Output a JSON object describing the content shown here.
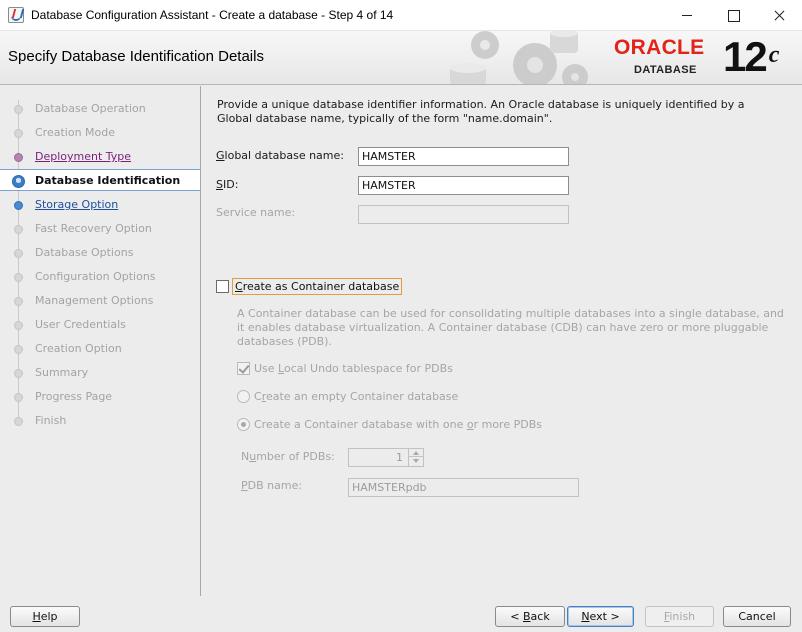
{
  "window": {
    "title": "Database Configuration Assistant - Create a database - Step 4 of 14"
  },
  "header": {
    "page_title": "Specify Database Identification Details",
    "brand_oracle": "ORACLE",
    "brand_database": "DATABASE",
    "brand_version": "12",
    "brand_version_sup": "c"
  },
  "nav": {
    "steps": [
      {
        "label": "Database Operation",
        "state": "inactive"
      },
      {
        "label": "Creation Mode",
        "state": "inactive"
      },
      {
        "label": "Deployment Type",
        "state": "done"
      },
      {
        "label": "Database Identification",
        "state": "current"
      },
      {
        "label": "Storage Option",
        "state": "next"
      },
      {
        "label": "Fast Recovery Option",
        "state": "inactive"
      },
      {
        "label": "Database Options",
        "state": "inactive"
      },
      {
        "label": "Configuration Options",
        "state": "inactive"
      },
      {
        "label": "Management Options",
        "state": "inactive"
      },
      {
        "label": "User Credentials",
        "state": "inactive"
      },
      {
        "label": "Creation Option",
        "state": "inactive"
      },
      {
        "label": "Summary",
        "state": "inactive"
      },
      {
        "label": "Progress Page",
        "state": "inactive"
      },
      {
        "label": "Finish",
        "state": "inactive"
      }
    ]
  },
  "main": {
    "intro": "Provide a unique database identifier information. An Oracle database is uniquely identified by a Global database name, typically of the form \"name.domain\".",
    "global_db_name": {
      "mnemonic": "G",
      "label_rest": "lobal database name:",
      "value": "HAMSTER"
    },
    "sid": {
      "mnemonic": "S",
      "label_rest": "ID:",
      "value": "HAMSTER"
    },
    "service_name": {
      "label": "Service name:",
      "value": ""
    },
    "container": {
      "checkbox_mnemonic": "C",
      "checkbox_label_rest": "reate as Container database",
      "checked": false,
      "description": "A Container database can be used for consolidating multiple databases into a single database, and it enables database virtualization. A Container database (CDB) can have zero or more pluggable databases (PDB).",
      "undo_pre": "Use ",
      "undo_mnemonic": "L",
      "undo_rest": "ocal Undo tablespace for PDBs",
      "undo_checked": true,
      "empty_cdb_pre": "C",
      "empty_cdb_mnemonic": "r",
      "empty_cdb_rest": "eate an empty Container database",
      "with_pdbs_pre": "Create a Container database with one ",
      "with_pdbs_mnemonic": "o",
      "with_pdbs_rest": "r more PDBs",
      "selected_option": "with_pdbs",
      "num_pdbs_pre": "N",
      "num_pdbs_mnemonic": "u",
      "num_pdbs_rest": "mber of PDBs:",
      "num_pdbs_value": "1",
      "pdb_name_pre": "",
      "pdb_name_mnemonic": "P",
      "pdb_name_rest": "DB name:",
      "pdb_name_value": "HAMSTERpdb"
    }
  },
  "footer": {
    "help": {
      "mnemonic": "H",
      "rest": "elp"
    },
    "back": {
      "pre": "< ",
      "mnemonic": "B",
      "rest": "ack"
    },
    "next": {
      "mnemonic": "N",
      "rest": "ext >"
    },
    "finish": {
      "mnemonic": "F",
      "rest": "inish"
    },
    "cancel": {
      "label": "Cancel"
    }
  }
}
